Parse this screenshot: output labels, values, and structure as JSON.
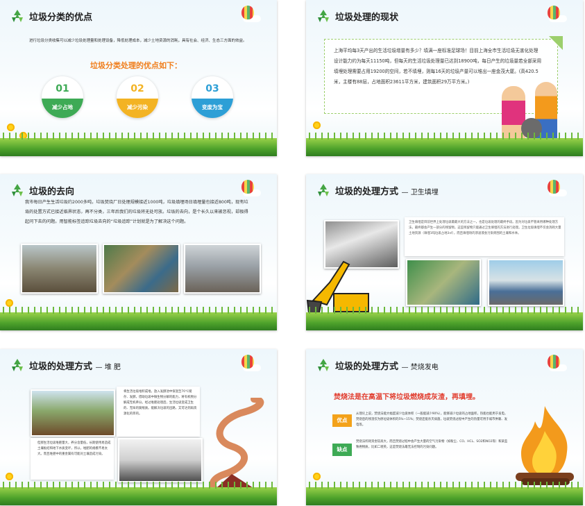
{
  "slides": [
    {
      "title": "垃圾分类的优点",
      "intro": "进行垃圾分类收集可以减少垃圾处理量和处理设备，降低处理成本，减少土地资源的消耗，具有社会、经济、生态三方面的效益。",
      "subheading": "垃圾分类处理的优点如下：",
      "items": [
        {
          "num": "01",
          "label": "减少占地",
          "color": "#3eaa55"
        },
        {
          "num": "02",
          "label": "减少污染",
          "color": "#f3b323"
        },
        {
          "num": "03",
          "label": "变废为宝",
          "color": "#2d9fd6"
        }
      ]
    },
    {
      "title": "垃圾处理的现状",
      "text": "上海平均每3天产出的生活垃圾增量有多少？填满一座标准足球场！目前上海全市生活垃圾无害化处理设计能力约为每天11150吨，但每天的生活垃圾处理量已达到18900吨，每日产生的垃圾量若全部采用填埋处理需要占用19200的空间，若不填埋，则每16天的垃圾产量可以堆出一座金茂大厦。(高420.5米，主楼有88层，占地面积23611平方米，建筑面积29万平方米。)"
    },
    {
      "title": "垃圾的去向",
      "text": "我市每日产生生活垃圾约2000多吨，垃圾焚烧厂日处理规模接近1000吨，垃圾填埋场日填埋量也接近800吨，现有垃圾的处置方式已接近临界状态，再不分类，三年后我们的垃圾将无处可放。垃圾的去向，是个长久以来被忽视，却极得起问下去的问题。用智能标签追踪垃圾去向的“垃圾追踪”计划就是为了解决这个问题。"
    },
    {
      "title": "垃圾的处理方式",
      "subtitle": "— 卫生填埋",
      "text": "卫生填埋是目前世界上处理垃圾最最大的方法之一，也是垃圾处理的最终手段。因为对垃圾不管采用哪种处理方法，最终都会产生一部分的残留物，这些残留物只能通过卫生填埋的方法进行处理。卫生垃圾填埋不仅会消耗大量土地资源（填埋1吨垃圾占地3㎡），而且填埋场的渗滤液会污染周围的土壤和水体。"
    },
    {
      "title": "垃圾的处理方式",
      "subtitle": "— 堆 肥",
      "text1": "将生活垃圾堆积成堆，放入发酵池中保温至70℃储存、发酵，借助垃圾中微生物分解的能力，将有机物分解成无机养分。经过堆肥处理后，生活垃圾变成卫生的、无味的腐殖质。能解决垃圾的出路，又可达到再资源化的目的。",
      "text2": "但那生活垃圾堆肥量大，养分含量低，长期使用易造成土壤板结和地下水质变坏，所以，堆肥的规模不易太大。而且堆肥中的重金属有可能对土壤造成污染。"
    },
    {
      "title": "垃圾的处理方式",
      "subtitle": "— 焚烧发电",
      "headline": "焚烧法是在高温下将垃圾燃烧成灰渣，再填埋。",
      "pros_label": "优点",
      "pros": "从理论上说，焚烧法能大幅度减少垃圾体积（一般能减少90%），能够减少垃圾的占地面积，热能也能用于发电，焚烧后的残渣仅为原垃圾体积的5%~15%；焚烧还能杀灭病菌，垃圾焚烧过程中产生的热量可用于城市供暖、发电等。",
      "cons_label": "缺点",
      "cons": "焚烧法所耗资金较高大，而且焚烧过程中会产生大量的空气污染物（如粉尘、CO、HCL、SO2和NO2等）和某些致癌物质，比如二噁英，这是焚烧法最无法控制的污染问题。"
    }
  ]
}
